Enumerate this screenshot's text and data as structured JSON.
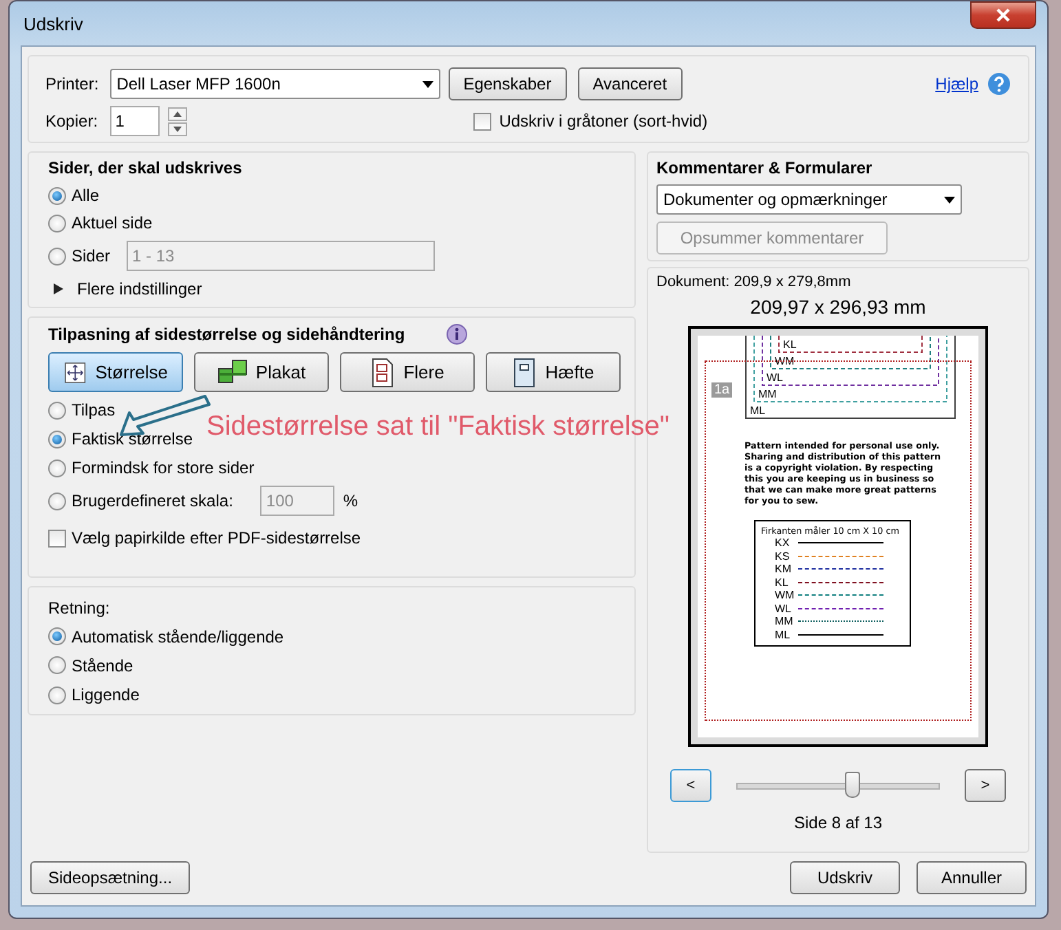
{
  "window": {
    "title": "Udskriv"
  },
  "printer": {
    "label": "Printer:",
    "value": "Dell Laser MFP 1600n"
  },
  "printer_buttons": [
    "Egenskaber",
    "Avanceret"
  ],
  "help": {
    "label": "Hjælp"
  },
  "copies": {
    "label": "Kopier:",
    "value": "1"
  },
  "grayscale": {
    "label": "Udskriv i gråtoner (sort-hvid)",
    "checked": false
  },
  "pages_section": {
    "title": "Sider, der skal udskrives",
    "options": [
      {
        "label": "Alle",
        "selected": true
      },
      {
        "label": "Aktuel side",
        "selected": false
      },
      {
        "label": "Sider",
        "selected": false
      }
    ],
    "range": {
      "value": "1 - 13",
      "disabled": true
    },
    "more": {
      "label": "Flere indstillinger",
      "expanded": false
    }
  },
  "sizing_section": {
    "title": "Tilpasning af sidestørrelse og sidehåndtering",
    "modes": [
      {
        "label": "Størrelse",
        "kind": "size",
        "selected": true
      },
      {
        "label": "Plakat",
        "kind": "poster",
        "selected": false
      },
      {
        "label": "Flere",
        "kind": "multiple",
        "selected": false
      },
      {
        "label": "Hæfte",
        "kind": "booklet",
        "selected": false
      }
    ],
    "options": [
      {
        "label": "Tilpas",
        "selected": false
      },
      {
        "label": "Faktisk størrelse",
        "selected": true
      },
      {
        "label": "Formindsk for store sider",
        "selected": false
      },
      {
        "label": "Brugerdefineret skala:",
        "selected": false
      }
    ],
    "scale": {
      "value": "100",
      "unit": "%",
      "disabled": true
    },
    "paper_source": {
      "label": "Vælg papirkilde efter PDF-sidestørrelse",
      "checked": false
    }
  },
  "orientation_section": {
    "title": "Retning:",
    "options": [
      {
        "label": "Automatisk stående/liggende",
        "selected": true
      },
      {
        "label": "Stående",
        "selected": false
      },
      {
        "label": "Liggende",
        "selected": false
      }
    ]
  },
  "comments_section": {
    "title": "Kommentarer & Formularer",
    "value": "Dokumenter og opmærkninger",
    "summary_button": {
      "label": "Opsummer kommentarer",
      "disabled": true
    }
  },
  "preview": {
    "document": "Dokument: 209,9 x 279,8mm",
    "size": "209,97 x 296,93 mm",
    "page": {
      "tag": "1a",
      "pattern_labels": [
        {
          "label": "KL",
          "color": "#a03040"
        },
        {
          "label": "WM",
          "color": "#208080"
        },
        {
          "label": "WL",
          "color": "#7030a0"
        },
        {
          "label": "MM",
          "color": "#40a0a0"
        },
        {
          "label": "ML",
          "color": "#404040"
        }
      ],
      "notice": "Pattern intended for personal use only. Sharing and distribution of this pattern is a copyright violation. By respecting this you are keeping us in business so that we can make more great patterns for you to sew.",
      "legend_title": "Firkanten måler 10 cm X 10 cm",
      "legend": [
        {
          "label": "KX",
          "color": "#000000",
          "kind": "solid"
        },
        {
          "label": "KS",
          "color": "#e08020",
          "kind": "dashed"
        },
        {
          "label": "KM",
          "color": "#2030a0",
          "kind": "dashdot"
        },
        {
          "label": "KL",
          "color": "#801020",
          "kind": "dashed"
        },
        {
          "label": "WM",
          "color": "#108080",
          "kind": "dashdot"
        },
        {
          "label": "WL",
          "color": "#7020b0",
          "kind": "dashed"
        },
        {
          "label": "MM",
          "color": "#106060",
          "kind": "dotted"
        },
        {
          "label": "ML",
          "color": "#000000",
          "kind": "solid"
        }
      ]
    },
    "prev": "<",
    "next": ">",
    "slider": {
      "level": 0.57
    },
    "page_label": "Side 8 af 13"
  },
  "footer": {
    "setup": "Sideopsætning...",
    "print": "Udskriv",
    "cancel": "Annuller"
  },
  "annotation": {
    "text": "Sidestørrelse sat til \"Faktisk størrelse\""
  }
}
